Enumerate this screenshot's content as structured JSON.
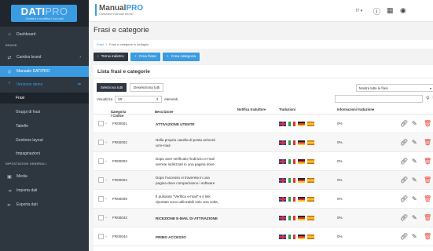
{
  "brand": {
    "logo_text": "DATI",
    "logo_text2": "PRO",
    "tagline": "Gestisci e modifica i tuoi dati",
    "app_name": "Manual",
    "app_name2": "PRO",
    "app_subtitle": "Creazione manuali tecnici",
    "accent": "#3b9be0"
  },
  "sidebar": {
    "dashboard": "Dashboard",
    "section_brand": "BRAND",
    "cambia_brand": "Cambia brand",
    "manuale": "Manuale DATIPRO",
    "versione": "Versione demo",
    "items": [
      "Frasi",
      "Gruppi di frasi",
      "Tabelle",
      "Gestione layout",
      "Impaginazioni"
    ],
    "section_settings": "IMPOSTAZIONI GENERALI",
    "media": "Media",
    "importa": "Importa dati",
    "esporta": "Esporta dati"
  },
  "topbar": {
    "lang": "IT ▾"
  },
  "page": {
    "title": "Frasi e categorie",
    "breadcrumb_home": "Frasi",
    "breadcrumb_sep": "/",
    "breadcrumb_current": "Frasi e categorie in dettaglio"
  },
  "actions": {
    "back": "Torna indietro",
    "new_phrase": "Crea frase",
    "new_category": "Crea categoria"
  },
  "panel": {
    "title": "Lista frasi e categorie",
    "select_all": "Seleziona tutti",
    "deselect_all": "Deseleziona tutti",
    "filter": "Mostra tutte le frasi",
    "vis_label": "Visualizza",
    "vis_value": "50",
    "vis_suffix": "elementi"
  },
  "table": {
    "headers": {
      "categoria": "Categoria / Codice",
      "descrizione": "Descrizione",
      "notifica": "Notifica traduttore",
      "traduzioni": "Traduzioni",
      "info": "Informazioni traduzione"
    },
    "rows": [
      {
        "code": "FR00001",
        "desc1": "ATTIVAZIONE UTENTE",
        "desc2": "",
        "pct": "0%"
      },
      {
        "code": "FR00002",
        "desc1": "Nella propria casella di posta arriverà",
        "desc2": "un'e-mail",
        "pct": "0%"
      },
      {
        "code": "FR00003",
        "desc1": "Dopo aver verificato l'indirizzo e-mail",
        "desc2": "verrete indirizzati in una pagina dove",
        "pct": "0%"
      },
      {
        "code": "FR00004",
        "desc1": "Dopo l'accesso vi troverete in una",
        "desc2": "pagina dove compariranno i software",
        "pct": "0%"
      },
      {
        "code": "FR00009",
        "desc1": "Il pulsante \"Verifica e-mail\" e il link",
        "desc2": "riportato sono utilizzabili solo una volta,",
        "pct": "0%"
      },
      {
        "code": "FR00043",
        "desc1": "RICEZIONE E-MAIL DI ATTIVAZIONE",
        "desc2": "",
        "pct": "0%"
      },
      {
        "code": "FR00044",
        "desc1": "PRIMO ACCESSO",
        "desc2": "",
        "pct": "0%"
      }
    ]
  }
}
